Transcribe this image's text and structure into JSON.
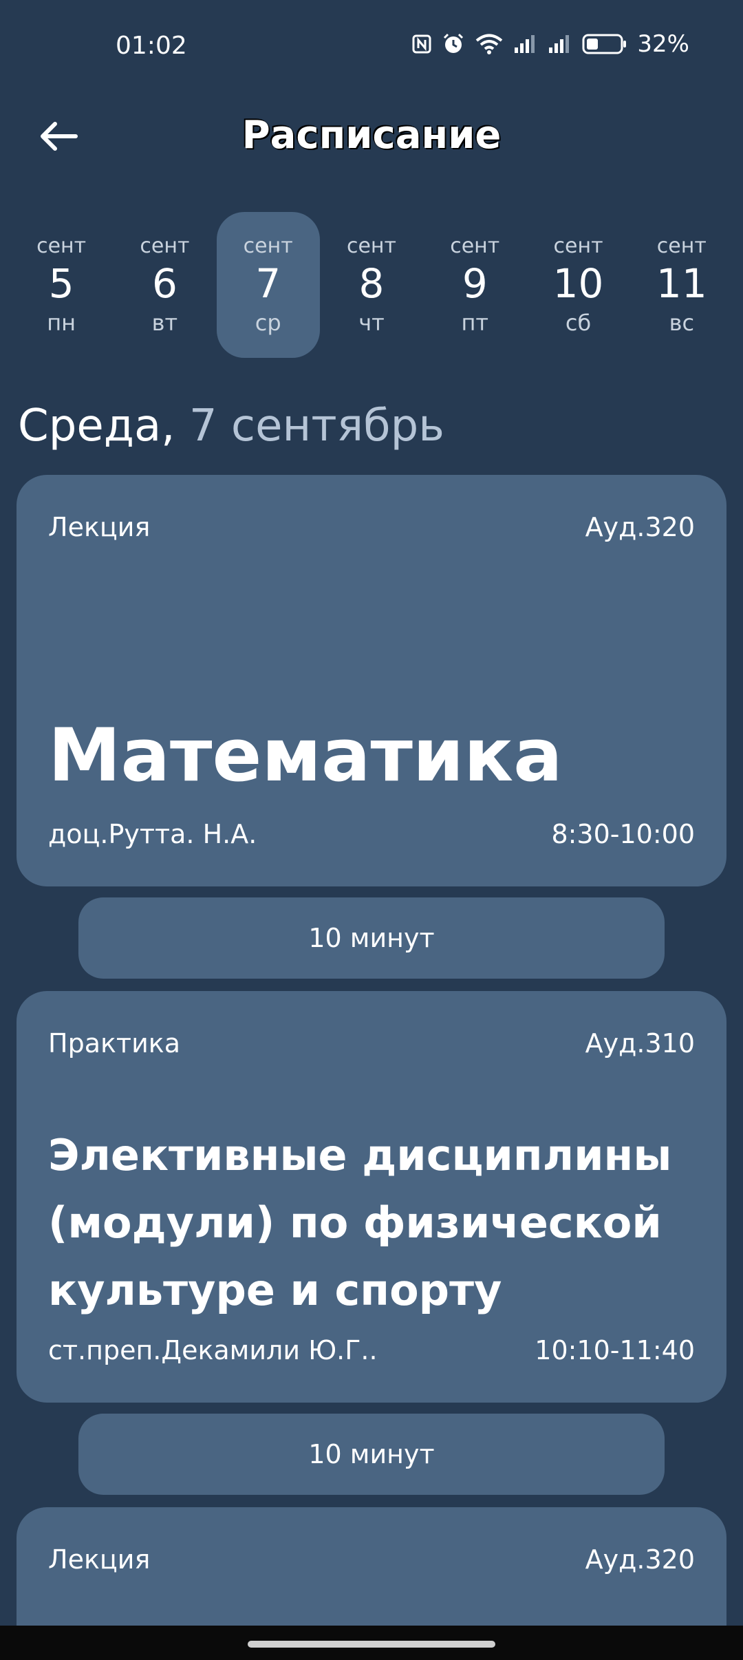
{
  "status_bar": {
    "time": "01:02",
    "battery": "32%",
    "icons": [
      "nfc-icon",
      "alarm-icon",
      "wifi-icon",
      "signal-icon",
      "signal-icon",
      "battery-icon"
    ]
  },
  "header": {
    "back_icon": "arrow-left-icon",
    "title": "Расписание"
  },
  "week": {
    "days": [
      {
        "month": "сент",
        "num": "5",
        "dow": "пн",
        "active": false
      },
      {
        "month": "сент",
        "num": "6",
        "dow": "вт",
        "active": false
      },
      {
        "month": "сент",
        "num": "7",
        "dow": "ср",
        "active": true
      },
      {
        "month": "сент",
        "num": "8",
        "dow": "чт",
        "active": false
      },
      {
        "month": "сент",
        "num": "9",
        "dow": "пт",
        "active": false
      },
      {
        "month": "сент",
        "num": "10",
        "dow": "сб",
        "active": false
      },
      {
        "month": "сент",
        "num": "11",
        "dow": "вс",
        "active": false
      }
    ]
  },
  "selected_date": {
    "weekday": "Среда,",
    "date": "7 сентябрь"
  },
  "lessons": [
    {
      "type": "Лекция",
      "room": "Ауд.320",
      "subject": "Математика",
      "teacher": "доц.Рутта. Н.А.",
      "time": "8:30-10:00"
    },
    {
      "type": "Практика",
      "room": "Ауд.310",
      "subject": "Элективные дисциплины (модули) по физической культуре и спорту",
      "teacher": "ст.преп.Декамили Ю.Г..",
      "time": "10:10-11:40"
    },
    {
      "type": "Лекция",
      "room": "Ауд.320"
    }
  ],
  "breaks": [
    "10 минут",
    "10 минут"
  ],
  "colors": {
    "background": "#263a52",
    "card": "#4a6582",
    "muted_text": "#b5c4d6"
  }
}
